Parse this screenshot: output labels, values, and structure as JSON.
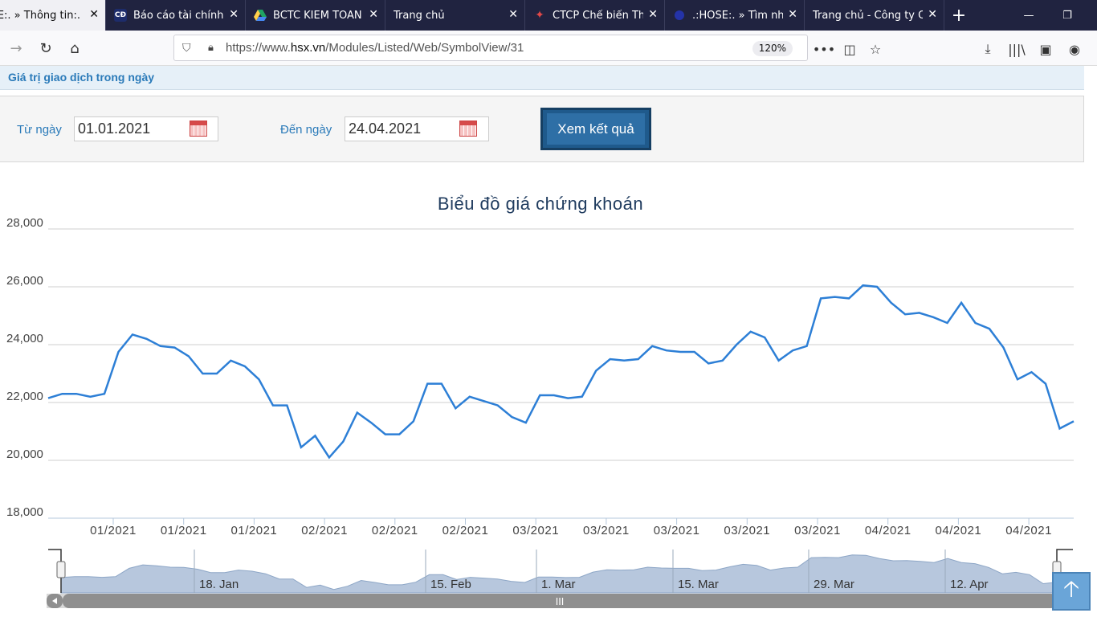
{
  "tabs": [
    {
      "title": ".:HOSE:. » Thông tin",
      "active": true
    },
    {
      "title": "Báo cáo tài chính",
      "icon": "cafef-icon"
    },
    {
      "title": "BCTC KIEM TOAN",
      "icon": "drive-icon"
    },
    {
      "title": "Trang chủ"
    },
    {
      "title": "CTCP Chế biến Th",
      "icon": "site-icon"
    },
    {
      "title": ".:HOSE:. » Tìm nhà",
      "icon": "hose-icon"
    },
    {
      "title": "Trang chủ - Công ty C"
    }
  ],
  "nav": {
    "url_prefix": "https://www.",
    "url_domain": "hsx.vn",
    "url_path": "/Modules/Listed/Web/SymbolView/31",
    "zoom": "120%"
  },
  "section": {
    "title": "Giá trị giao dịch trong ngày"
  },
  "filter": {
    "from_label": "Từ ngày",
    "from_value": "01.01.2021",
    "to_label": "Đến ngày",
    "to_value": "24.04.2021",
    "submit_label": "Xem kết quả"
  },
  "chart_data": {
    "type": "line",
    "title": "Biểu đồ giá chứng khoán",
    "ylim": [
      18000,
      28000
    ],
    "yticks": [
      "28,000",
      "26,000",
      "24,000",
      "22,000",
      "20,000",
      "18,000"
    ],
    "ytick_values": [
      28000,
      26000,
      24000,
      22000,
      20000,
      18000
    ],
    "xticks": [
      "01/2021",
      "01/2021",
      "01/2021",
      "02/2021",
      "02/2021",
      "02/2021",
      "03/2021",
      "03/2021",
      "03/2021",
      "03/2021",
      "03/2021",
      "04/2021",
      "04/2021",
      "04/2021"
    ],
    "navigator_labels": [
      "18. Jan",
      "15. Feb",
      "1. Mar",
      "15. Mar",
      "29. Mar",
      "12. Apr"
    ],
    "grid": true,
    "color": "#2d7fd6",
    "values": [
      22150,
      22300,
      22300,
      22200,
      22300,
      23750,
      24350,
      24200,
      23950,
      23900,
      23600,
      23000,
      23000,
      23450,
      23250,
      22800,
      21900,
      21900,
      20450,
      20850,
      20100,
      20650,
      21650,
      21300,
      20900,
      20900,
      21350,
      22650,
      22650,
      21800,
      22200,
      22050,
      21900,
      21500,
      21300,
      22250,
      22250,
      22150,
      22200,
      23100,
      23500,
      23450,
      23500,
      23950,
      23800,
      23750,
      23750,
      23350,
      23450,
      24000,
      24450,
      24250,
      23450,
      23800,
      23950,
      25600,
      25650,
      25600,
      26050,
      26000,
      25450,
      25050,
      25100,
      24950,
      24750,
      25450,
      24750,
      24550,
      23900,
      22800,
      23050,
      22650,
      21100,
      21350
    ]
  }
}
